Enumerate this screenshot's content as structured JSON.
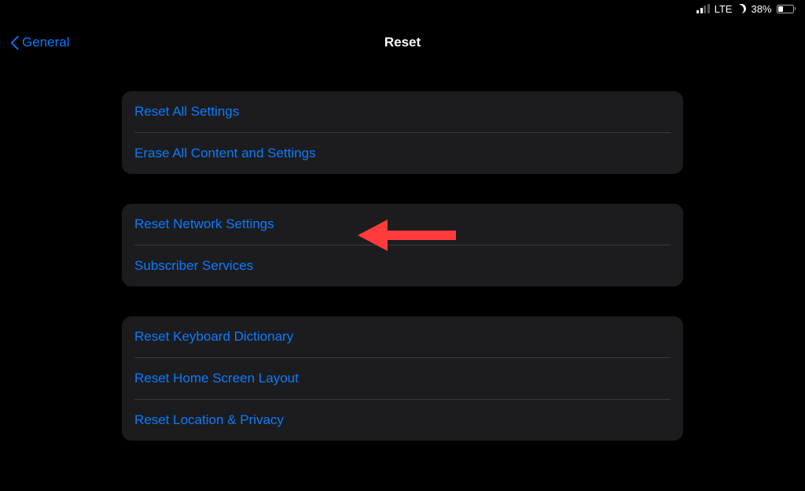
{
  "status_bar": {
    "carrier": "LTE",
    "battery_percent": "38%"
  },
  "nav": {
    "back_label": "General",
    "title": "Reset"
  },
  "groups": [
    {
      "items": [
        {
          "label": "Reset All Settings",
          "name": "reset-all-settings"
        },
        {
          "label": "Erase All Content and Settings",
          "name": "erase-all-content-settings"
        }
      ]
    },
    {
      "items": [
        {
          "label": "Reset Network Settings",
          "name": "reset-network-settings"
        },
        {
          "label": "Subscriber Services",
          "name": "subscriber-services"
        }
      ]
    },
    {
      "items": [
        {
          "label": "Reset Keyboard Dictionary",
          "name": "reset-keyboard-dictionary"
        },
        {
          "label": "Reset Home Screen Layout",
          "name": "reset-home-screen-layout"
        },
        {
          "label": "Reset Location & Privacy",
          "name": "reset-location-privacy"
        }
      ]
    }
  ]
}
